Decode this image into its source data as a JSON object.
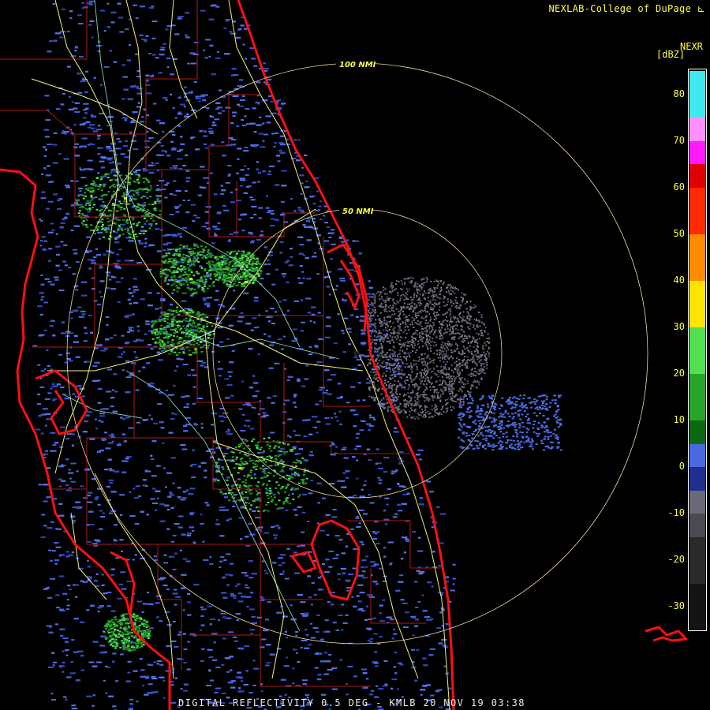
{
  "header": {
    "credit": "NEXLAB-College of DuPage",
    "logo_icon": "cod-logo-icon"
  },
  "legend": {
    "product": "NEXR",
    "unit": "[dBZ]",
    "ticks": [
      "80",
      "70",
      "60",
      "50",
      "40",
      "30",
      "20",
      "10",
      "0",
      "-10",
      "-20",
      "-30"
    ],
    "tick_values": [
      80,
      70,
      60,
      50,
      40,
      30,
      20,
      10,
      0,
      -10,
      -20,
      -30
    ],
    "range": [
      -35,
      85
    ],
    "colors": [
      "#141414",
      "#2a2a2a",
      "#4a4a52",
      "#6a6a7a",
      "#1e2f90",
      "#4a6ae0",
      "#0a6a14",
      "#28a428",
      "#50e050",
      "#ffe400",
      "#ff8c00",
      "#ff2a00",
      "#e00000",
      "#ff1aff",
      "#ff90ff",
      "#40e8f0"
    ],
    "color_bounds": [
      -35,
      -25,
      -15,
      -10,
      -5,
      0,
      5,
      10,
      20,
      30,
      40,
      50,
      60,
      65,
      70,
      75,
      85
    ]
  },
  "rings": [
    {
      "label": "100 NMI",
      "radius_nmi": 100
    },
    {
      "label": "50 NMI",
      "radius_nmi": 50
    }
  ],
  "caption": "DIGITAL REFLECTIVITY 0.5 DEG - KMLB 20 NOV 19 03:38",
  "colors": {
    "coast": "#ff1010",
    "roads": "#f2f27a",
    "counties": "#b01818",
    "rivers": "#7fd0c0",
    "text": "#ffff40",
    "ring": "#f0d8a0"
  }
}
